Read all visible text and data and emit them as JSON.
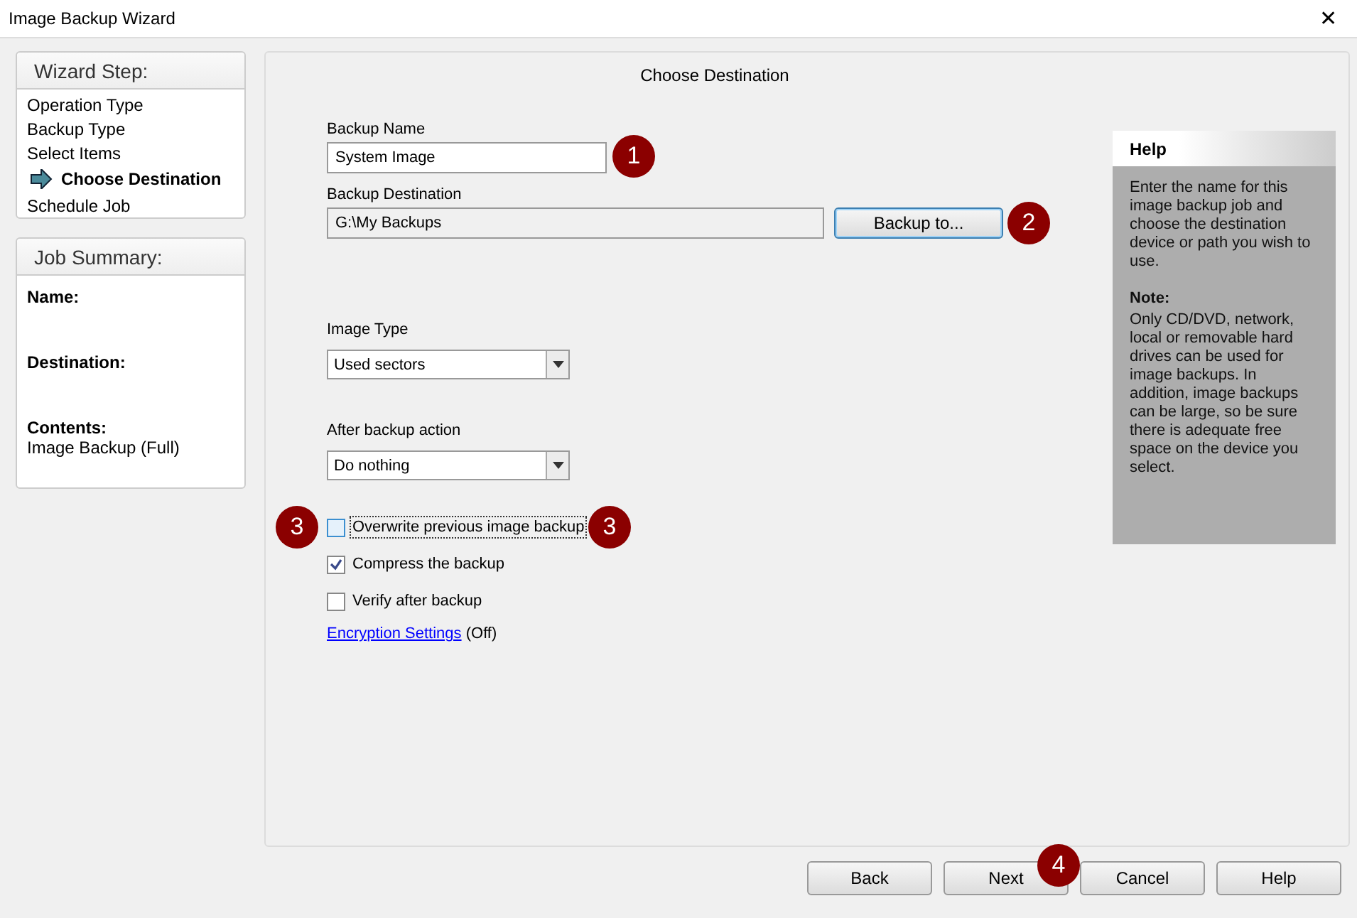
{
  "window": {
    "title": "Image Backup Wizard",
    "close": "✕"
  },
  "wizard_steps": {
    "title": "Wizard Step:",
    "items": [
      {
        "label": "Operation Type",
        "selected": false
      },
      {
        "label": "Backup Type",
        "selected": false
      },
      {
        "label": "Select Items",
        "selected": false
      },
      {
        "label": "Choose Destination",
        "selected": true
      },
      {
        "label": "Schedule Job",
        "selected": false
      }
    ]
  },
  "job_summary": {
    "title": "Job Summary:",
    "items": [
      {
        "label": "Name:"
      },
      {
        "label": "Destination:"
      },
      {
        "label": "Contents:",
        "value": "Image Backup (Full)"
      }
    ]
  },
  "page": {
    "title": "Choose Destination",
    "backup_name": {
      "label": "Backup Name",
      "value": "System Image"
    },
    "backup_destination": {
      "label": "Backup Destination",
      "value": "G:\\My Backups",
      "button": "Backup to...",
      "button_focused": true
    },
    "image_type": {
      "label": "Image Type",
      "value": "Used sectors"
    },
    "after_backup": {
      "label": "After backup action",
      "value": "Do nothing"
    },
    "options": [
      {
        "label": "Overwrite previous image backup",
        "checked": false,
        "focused": true
      },
      {
        "label": "Compress the backup",
        "checked": true,
        "focused": false
      },
      {
        "label": "Verify after backup",
        "checked": false,
        "focused": false
      }
    ],
    "encryption": {
      "link": "Encryption Settings",
      "state": "(Off)"
    }
  },
  "help": {
    "title": "Help",
    "text": "Enter the name for this image backup job and choose the destination device or path you wish to use.",
    "note_title": "Note:",
    "note": "Only CD/DVD, network, local or removable hard drives can be used for image backups.  In addition, image backups can be large, so be sure there is adequate free space on the device you select."
  },
  "buttons": [
    "Back",
    "Next",
    "Cancel",
    "Help"
  ],
  "callouts": [
    "1",
    "2",
    "3",
    "3",
    "4"
  ]
}
